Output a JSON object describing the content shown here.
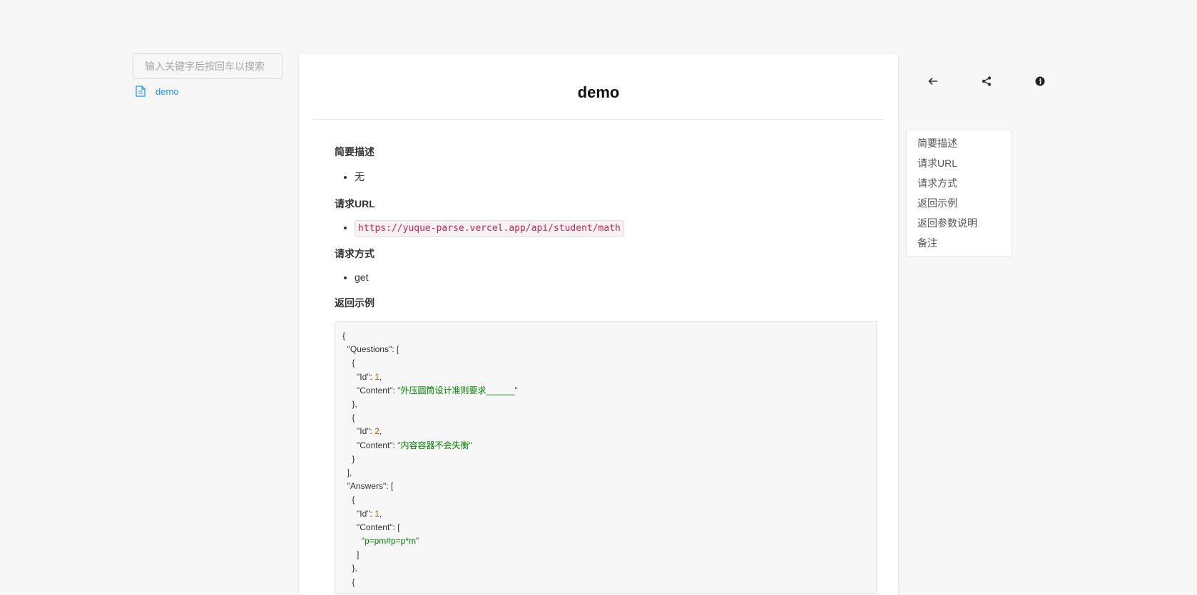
{
  "sidebar": {
    "search_placeholder": "输入关键字后按回车以搜索",
    "items": [
      {
        "label": "demo",
        "icon": "file-text-icon"
      }
    ]
  },
  "doc": {
    "title": "demo",
    "sections": {
      "desc": {
        "heading": "简要描述",
        "item": "无"
      },
      "url": {
        "heading": "请求URL",
        "item": "https://yuque-parse.vercel.app/api/student/math"
      },
      "method": {
        "heading": "请求方式",
        "item": "get"
      },
      "example": {
        "heading": "返回示例"
      }
    },
    "code": {
      "content_1": "外压圆筒设计准则要求______",
      "content_2": "内容容器不会失衡",
      "answer_1": "p=pm#p=p*m"
    }
  },
  "actions": [
    {
      "name": "back",
      "icon": "arrow-left-icon"
    },
    {
      "name": "share",
      "icon": "share-icon"
    },
    {
      "name": "info",
      "icon": "info-icon"
    }
  ],
  "toc": {
    "items": [
      "简要描述",
      "请求URL",
      "请求方式",
      "返回示例",
      "返回参数说明",
      "备注"
    ]
  },
  "colors": {
    "link": "#1890ff",
    "code_string": "#008000",
    "code_number": "#aa5d00",
    "code_inline": "#c7254e"
  }
}
